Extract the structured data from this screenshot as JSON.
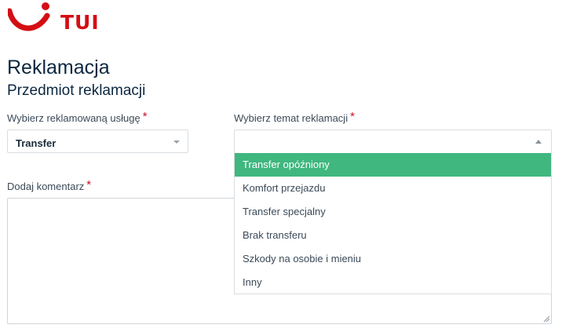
{
  "brand": {
    "name": "TUI",
    "color": "#d40e14",
    "logo_icon": "tui-smile-logo"
  },
  "page": {
    "title": "Reklamacja",
    "subtitle": "Przedmiot reklamacji"
  },
  "form": {
    "required_marker": "*",
    "service": {
      "label": "Wybierz reklamowaną usługę",
      "value": "Transfer"
    },
    "topic": {
      "label": "Wybierz temat reklamacji",
      "value": "",
      "open": true,
      "options": [
        {
          "label": "Transfer opóźniony",
          "highlighted": true
        },
        {
          "label": "Komfort przejazdu",
          "highlighted": false
        },
        {
          "label": "Transfer specjalny",
          "highlighted": false
        },
        {
          "label": "Brak transferu",
          "highlighted": false
        },
        {
          "label": "Szkody na osobie i mieniu",
          "highlighted": false
        },
        {
          "label": "Inny",
          "highlighted": false
        }
      ],
      "highlight_color": "#3fb77f"
    },
    "comment": {
      "label": "Dodaj komentarz",
      "value": ""
    }
  }
}
